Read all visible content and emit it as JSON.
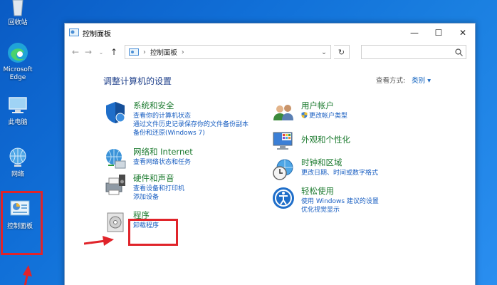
{
  "desktop": {
    "recycle_bin": "回收站",
    "edge": "Microsoft Edge",
    "this_pc": "此电脑",
    "network": "网络",
    "control_panel": "控制面板"
  },
  "window": {
    "title": "控制面板",
    "address": "控制面板",
    "heading": "调整计算机的设置",
    "view_by_label": "查看方式:",
    "view_by_value": "类别"
  },
  "categories": {
    "system": {
      "title": "系统和安全",
      "links": [
        "查看你的计算机状态",
        "通过文件历史记录保存你的文件备份副本",
        "备份和还原(Windows 7)"
      ]
    },
    "network": {
      "title": "网络和 Internet",
      "links": [
        "查看网络状态和任务"
      ]
    },
    "hardware": {
      "title": "硬件和声音",
      "links": [
        "查看设备和打印机",
        "添加设备"
      ]
    },
    "programs": {
      "title": "程序",
      "links": [
        "卸载程序"
      ]
    },
    "accounts": {
      "title": "用户帐户",
      "links": [
        "更改帐户类型"
      ]
    },
    "appearance": {
      "title": "外观和个性化",
      "links": []
    },
    "clock": {
      "title": "时钟和区域",
      "links": [
        "更改日期、时间或数字格式"
      ]
    },
    "ease": {
      "title": "轻松使用",
      "links": [
        "使用 Windows 建议的设置",
        "优化视觉显示"
      ]
    }
  }
}
